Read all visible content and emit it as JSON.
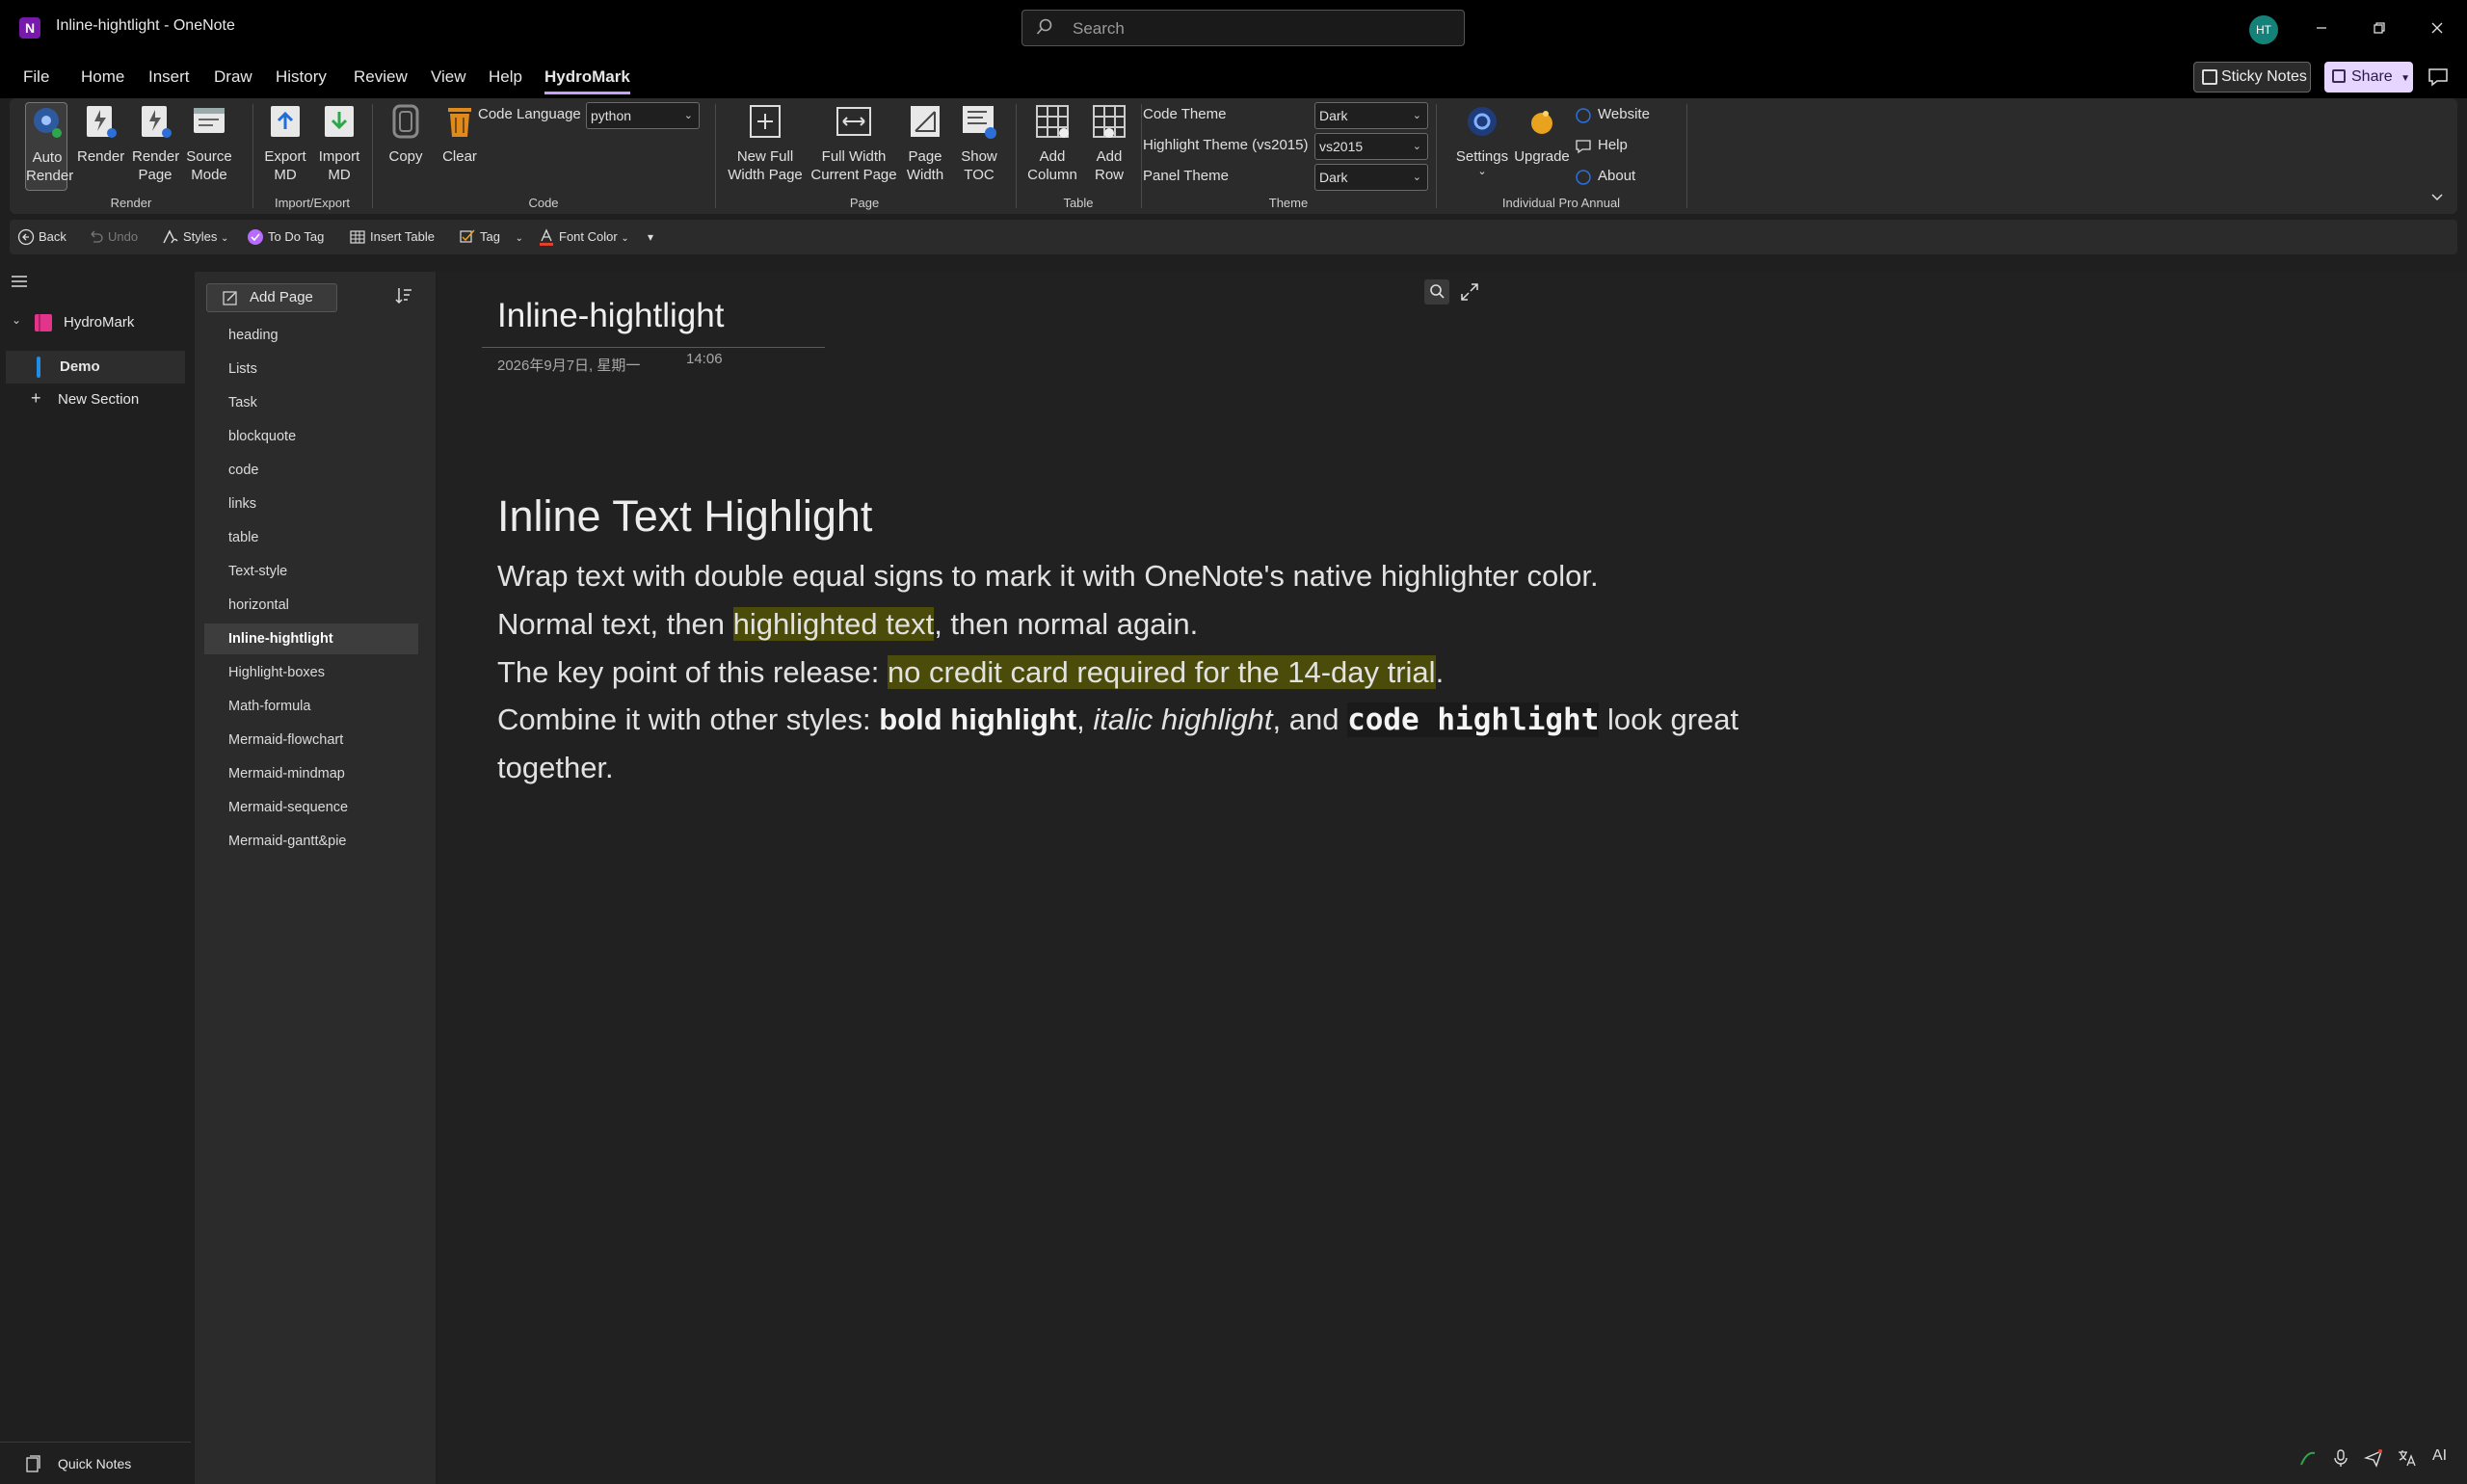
{
  "window": {
    "title": "Inline-hightlight  -  OneNote",
    "search_placeholder": "Search",
    "avatar_initials": "HT",
    "app_icon_letter": "N"
  },
  "menu": {
    "tabs": [
      "File",
      "Home",
      "Insert",
      "Draw",
      "History",
      "Review",
      "View",
      "Help",
      "HydroMark"
    ],
    "active_tab": "HydroMark",
    "sticky_notes": "Sticky Notes",
    "share": "Share"
  },
  "ribbon": {
    "render_group": {
      "label": "Render",
      "auto_render": "Auto Render",
      "render": "Render",
      "render_page": "Render Page",
      "source_mode": "Source Mode"
    },
    "import_export_group": {
      "label": "Import/Export",
      "export_md": "Export MD",
      "import_md": "Import MD"
    },
    "code_group": {
      "label": "Code",
      "copy": "Copy",
      "clear": "Clear",
      "code_language_label": "Code Language",
      "code_language_value": "python"
    },
    "page_group": {
      "label": "Page",
      "new_full_width_page": "New Full Width Page",
      "full_width_current_page": "Full Width Current Page",
      "page_width": "Page Width",
      "show_toc": "Show TOC"
    },
    "table_group": {
      "label": "Table",
      "add_column": "Add Column",
      "add_row": "Add Row"
    },
    "theme_group": {
      "label": "Theme",
      "code_theme_label": "Code Theme",
      "code_theme_value": "Dark",
      "highlight_theme_label": "Highlight Theme (vs2015)",
      "highlight_theme_value": "vs2015",
      "panel_theme_label": "Panel Theme",
      "panel_theme_value": "Dark"
    },
    "pro_group": {
      "label": "Individual Pro Annual",
      "settings": "Settings",
      "upgrade": "Upgrade",
      "website": "Website",
      "help": "Help",
      "about": "About"
    }
  },
  "quick_toolbar": {
    "back": "Back",
    "undo": "Undo",
    "styles": "Styles",
    "todo_tag": "To Do Tag",
    "insert_table": "Insert Table",
    "tag": "Tag",
    "font_color": "Font Color"
  },
  "notebook": {
    "name": "HydroMark",
    "color": "#e3348c",
    "sections": [
      {
        "name": "Demo",
        "color": "#1f8ce6",
        "active": true
      }
    ],
    "new_section": "New Section",
    "quick_notes": "Quick Notes"
  },
  "pages": {
    "add_page": "Add Page",
    "items": [
      "heading",
      "Lists",
      "Task",
      "blockquote",
      "code",
      "links",
      "table",
      "Text-style",
      "horizontal",
      "Inline-hightlight",
      "Highlight-boxes",
      "Math-formula",
      "Mermaid-flowchart",
      "Mermaid-mindmap",
      "Mermaid-sequence",
      "Mermaid-gantt&pie"
    ],
    "active": "Inline-hightlight"
  },
  "page": {
    "title": "Inline-hightlight",
    "date": "2026年9月7日, 星期一",
    "time": "14:06",
    "heading": "Inline Text Highlight",
    "p1": "Wrap text with double equal signs to mark it with OneNote's native highlighter color.",
    "p2_a": "Normal text, then ",
    "p2_hl": "highlighted text",
    "p2_b": ", then normal again.",
    "p3_a": "The key point of this release: ",
    "p3_hl": "no credit card required for the 14-day trial",
    "p3_b": ".",
    "p4_a": "Combine it with other styles: ",
    "p4_bold": "bold highlight",
    "p4_comma": ", ",
    "p4_italic": "italic highlight",
    "p4_and": ", and ",
    "p4_code": "code highlight",
    "p4_b": " look great",
    "p5": "together.",
    "highlight_color": "#4c4c0a"
  },
  "status_bar": {
    "ai": "AI"
  },
  "colors": {
    "accent": "#c7a0ff",
    "background": "#1f1f1f",
    "ribbon": "#2b2b2b"
  }
}
